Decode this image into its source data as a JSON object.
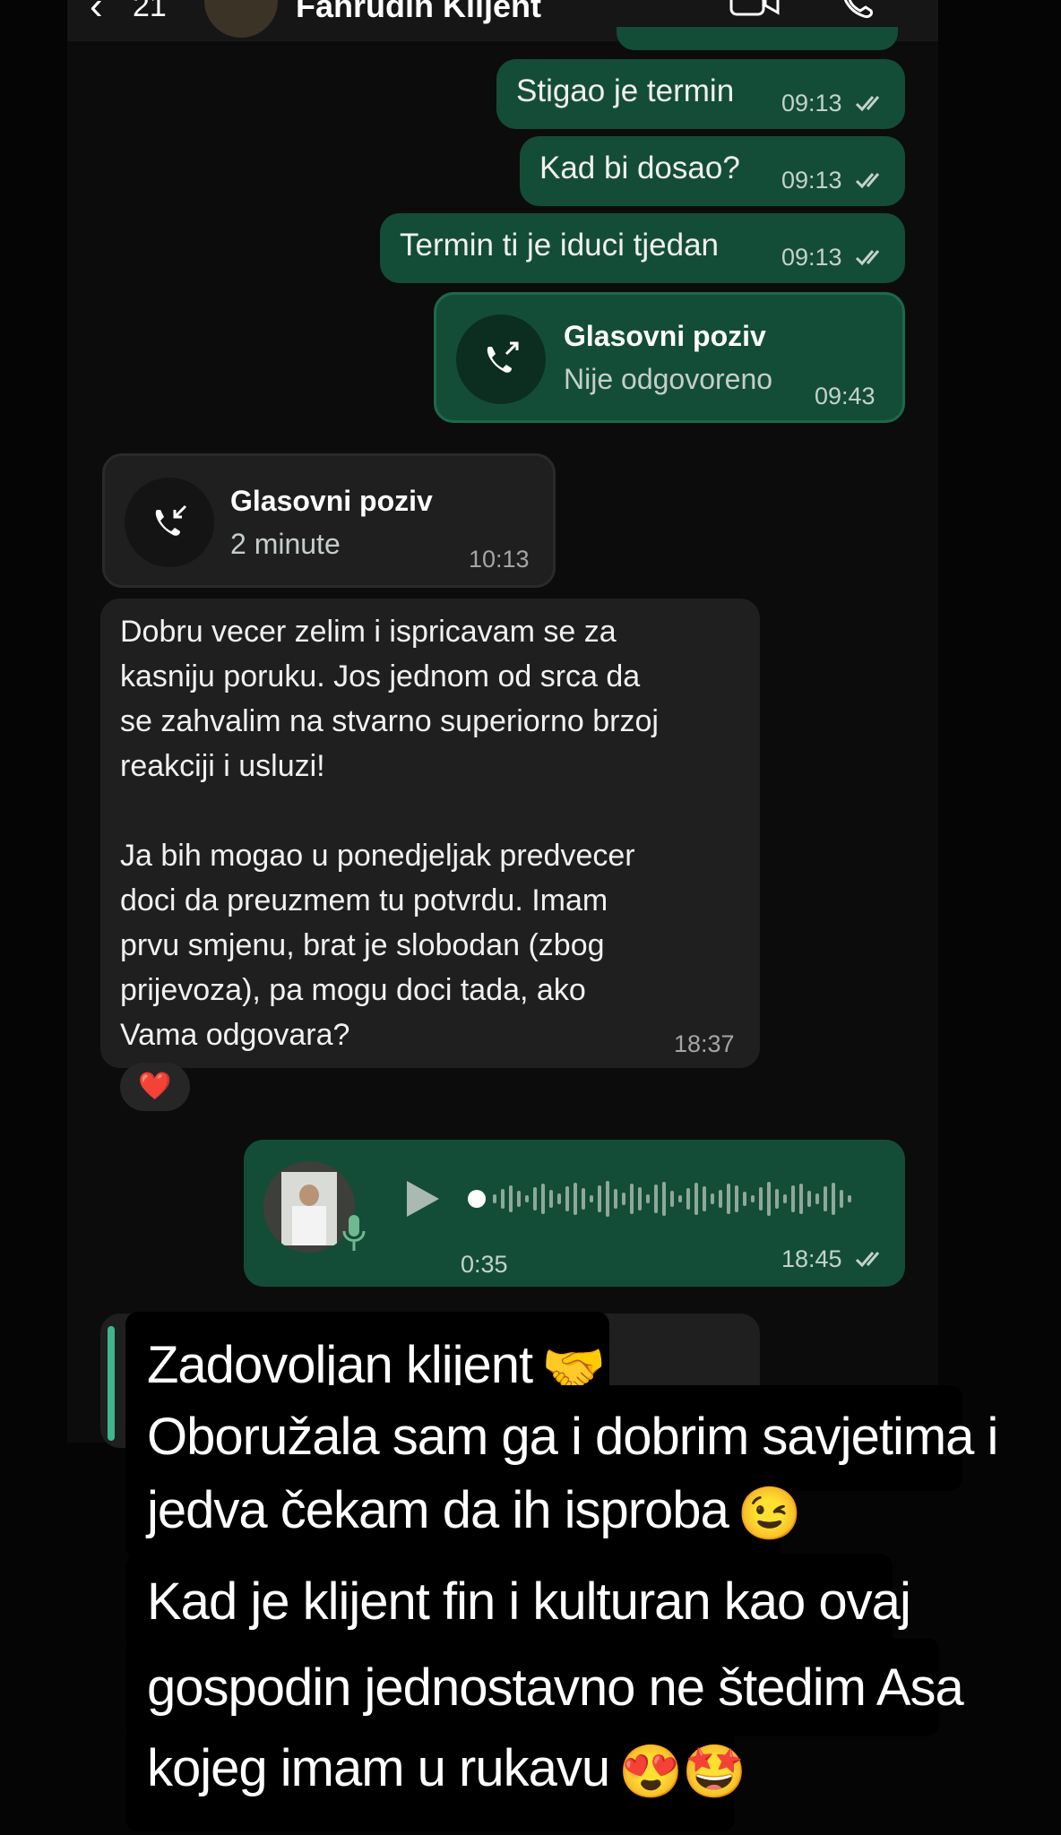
{
  "header": {
    "back_count": "21",
    "contact_name": "Fahrudin Klijent",
    "video_icon": "video-camera-icon",
    "call_icon": "phone-icon"
  },
  "messages": {
    "m1": {
      "text": "Stigao je termin",
      "time": "09:13"
    },
    "m2": {
      "text": "Kad bi dosao?",
      "time": "09:13"
    },
    "m3": {
      "text": "Termin ti je iduci tjedan",
      "time": "09:13"
    },
    "call_out": {
      "title": "Glasovni poziv",
      "subtitle": "Nije odgovoreno",
      "time": "09:43"
    },
    "call_in": {
      "title": "Glasovni poziv",
      "subtitle": "2 minute",
      "time": "10:13"
    },
    "long_in": {
      "paragraph1": "Dobru vecer zelim i ispricavam se za\nkasniju poruku. Jos jednom od srca da\nse zahvalim na stvarno superiorno brzoj\nreakciji i usluzi!",
      "paragraph2": "Ja bih mogao u ponedjeljak predvecer\ndoci da preuzmem tu potvrdu. Imam\nprvu smjenu, brat je slobodan (zbog\nprijevoza), pa mogu doci tada, ako\nVama odgovara?",
      "time": "18:37",
      "reaction": "❤️"
    },
    "voice": {
      "duration": "0:35",
      "time": "18:45",
      "progress": 0
    }
  },
  "story_text": {
    "line1": "Zadovoljan klijent",
    "line1_emoji": "🤝",
    "line2": "Oboružala sam ga i dobrim savjetima i",
    "line3": "jedva čekam da ih isproba",
    "line3_emoji": "😉",
    "line4": "Kad je klijent fin i kulturan kao ovaj",
    "line5": "gospodin jednostavno ne štedim Asa",
    "line6": "kojeg imam u rukavu",
    "line6_emoji": "😍🤩"
  },
  "colors": {
    "outgoing_bubble": "#144d37",
    "incoming_bubble": "#1f1f1f",
    "background": "#0c0c0c",
    "story_box": "#000000"
  }
}
